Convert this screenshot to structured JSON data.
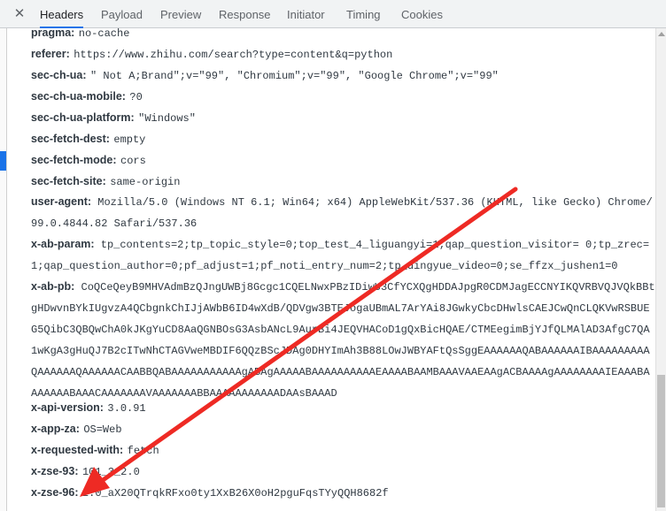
{
  "tabs": {
    "close_glyph": "✕",
    "items": [
      "Headers",
      "Payload",
      "Preview",
      "Response",
      "Initiator",
      "Timing",
      "Cookies"
    ],
    "active": "Headers"
  },
  "headers": [
    {
      "name": "pragma:",
      "value": "no-cache"
    },
    {
      "name": "referer:",
      "value": "https://www.zhihu.com/search?type=content&q=python"
    },
    {
      "name": "sec-ch-ua:",
      "value": "\" Not A;Brand\";v=\"99\", \"Chromium\";v=\"99\", \"Google Chrome\";v=\"99\""
    },
    {
      "name": "sec-ch-ua-mobile:",
      "value": "?0"
    },
    {
      "name": "sec-ch-ua-platform:",
      "value": "\"Windows\""
    },
    {
      "name": "sec-fetch-dest:",
      "value": "empty"
    },
    {
      "name": "sec-fetch-mode:",
      "value": "cors"
    },
    {
      "name": "sec-fetch-site:",
      "value": "same-origin"
    },
    {
      "name": "user-agent:",
      "value": "Mozilla/5.0 (Windows NT 6.1; Win64; x64) AppleWebKit/537.36 (KHTML, like Gecko) Chrome/99.0.4844.82 Safari/537.36"
    },
    {
      "name": "x-ab-param:",
      "value": "tp_contents=2;tp_topic_style=0;top_test_4_liguangyi=1;qap_question_visitor= 0;tp_zrec=1;qap_question_author=0;pf_adjust=1;pf_noti_entry_num=2;tp_dingyue_video=0;se_ffzx_jushen1=0"
    },
    {
      "name": "x-ab-pb:",
      "value": "CoQCeQeyB9MHVAdmBzQJngUWBj8Gcgc1CQELNwxPBzIDiwU3CfYCXQgHDDAJpgR0CDMJagECCNYIKQVRBVQJVQkBBtgHDwvnBYkIUgvzA4QCbgnkChIJjAWbB6ID4wXdB/QDVgw3BTEJogaUBmAL7ArYAi8JGwkyCbcDHwlsCAEJCwQnCLQKVwRSBUEG5QibC3QBQwChA0kJKgYuCD8AaQGNBOsG3AsbANcL9AurBi4JEQVHACoD1gQxBicHQAE/CTMEegimBjYJfQLMAlAD3AfgC7QA1wKgA3gHuQJ7B2cITwNhCTAGVweMBDIF6QQzBScJDAg0DHYImAh3B88LOwJWBYAFtQsSggEAAAAAAQABAAAAAAIBAAAAAAAAAQAAAAAAQAAAAAACAABBQABAAAAAAAAAAAgABAgAAAAABAAAAAAAAAAEAAAABAAMBAAAVAAEAAgACBAAAAgAAAAAAAAIEAAABAAAAAAABAAACAAAAAAAVAAAAAAABBAAAAAAAAAAADAAsBAAAD"
    },
    {
      "name": "x-api-version:",
      "value": "3.0.91"
    },
    {
      "name": "x-app-za:",
      "value": "OS=Web"
    },
    {
      "name": "x-requested-with:",
      "value": "fetch"
    },
    {
      "name": "x-zse-93:",
      "value": "101_3_2.0"
    },
    {
      "name": "x-zse-96:",
      "value": "2.0_aX20QTrqkRFxo0ty1XxB26X0oH2pguFqsTYyQQH8682f"
    }
  ],
  "annotation": {
    "type": "arrow",
    "color": "#ee2a24"
  },
  "colors": {
    "tab_active_underline": "#1a73e8",
    "text": "#303942",
    "arrow": "#ee2a24"
  }
}
